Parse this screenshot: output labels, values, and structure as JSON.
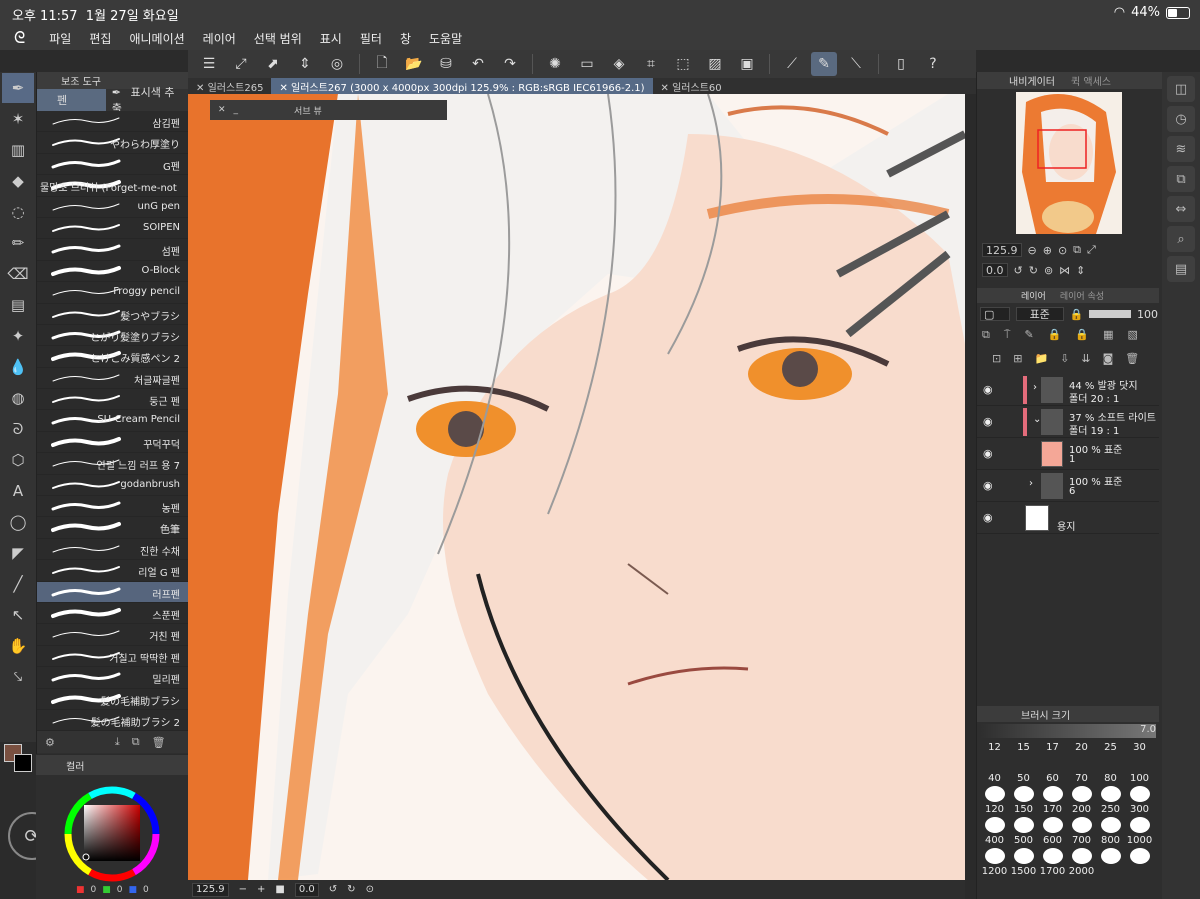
{
  "status": {
    "time": "오후 11:57",
    "date": "1월 27일 화요일",
    "battery": "44%",
    "battery_level": 0.44
  },
  "menu": [
    "파일",
    "편집",
    "애니메이션",
    "레이어",
    "선택 범위",
    "표시",
    "필터",
    "창",
    "도움말"
  ],
  "subtool_panel": {
    "tab1": "보조 도구",
    "pen_tab": "펜",
    "picker_tab": "표시색 추출"
  },
  "brushes": [
    "삼김펜",
    "やわらわ厚塗り",
    "G펜",
    "물망초 브러쉬 (Forget-me-not Flo",
    "unG pen",
    "SOIPEN",
    "섬펜",
    "O-Block",
    "Froggy pencil",
    "髪つやブラシ",
    "とがり髪塗りブラシ",
    "とけこみ質感ペン 2",
    "처글짜글펜",
    "둥근 펜",
    "SU-Cream Pencil",
    "꾸덕꾸덕",
    "연필 느낌 러프 용 7",
    "godanbrush",
    "농펜",
    "色筆",
    "진한 수채",
    "리얼 G 펜",
    "러프펜",
    "스푼펜",
    "거친 펜",
    "거칠고 딱딱한 펜",
    "밀리펜",
    "髪の毛補助ブラシ",
    "髪の毛補助ブラシ 2"
  ],
  "selected_brush": "러프펜",
  "tabs": [
    {
      "label": "일러스트265",
      "active": false
    },
    {
      "label": "일러스트267 (3000 x 4000px 300dpi 125.9% : RGB:sRGB IEC61966-2.1)",
      "active": true
    },
    {
      "label": "일러스트60",
      "active": false
    }
  ],
  "subview": {
    "label": "서브 뷰"
  },
  "canvas_bar": {
    "zoom": "125.9",
    "angle": "0.0"
  },
  "navigator": {
    "tab1": "내비게이터",
    "tab2": "퀵 액세스",
    "zoom": "125.9",
    "angle": "0.0"
  },
  "layers_panel": {
    "tab1": "레이어",
    "tab2": "레이어 속성",
    "blend": "표준",
    "opacity": "100"
  },
  "layers": [
    {
      "line1": "44 % 발광 닷지",
      "line2": "폴더 20 : 1",
      "folder": true
    },
    {
      "line1": "37 % 소프트 라이트",
      "line2": "폴더 19 : 1",
      "folder": true
    },
    {
      "line1": "100 % 표준",
      "line2": "1",
      "folder": false
    },
    {
      "line1": "100 % 표준",
      "line2": "6",
      "folder": true
    },
    {
      "line1": "",
      "line2": "용지",
      "folder": false
    }
  ],
  "brush_size_panel": {
    "title": "브러시 크기",
    "value": "7.0",
    "sizes": [
      "12",
      "15",
      "17",
      "20",
      "25",
      "30",
      "40",
      "50",
      "60",
      "70",
      "80",
      "100",
      "120",
      "150",
      "170",
      "200",
      "250",
      "300",
      "400",
      "500",
      "600",
      "700",
      "800",
      "1000",
      "1200",
      "1500",
      "1700",
      "2000"
    ]
  },
  "color_panel": {
    "tab": "컬러",
    "r": "0",
    "g": "0",
    "b": "0"
  },
  "colors": {
    "accent": "#566a86",
    "main_color": "#7a5040",
    "sub_color": "#000000"
  }
}
